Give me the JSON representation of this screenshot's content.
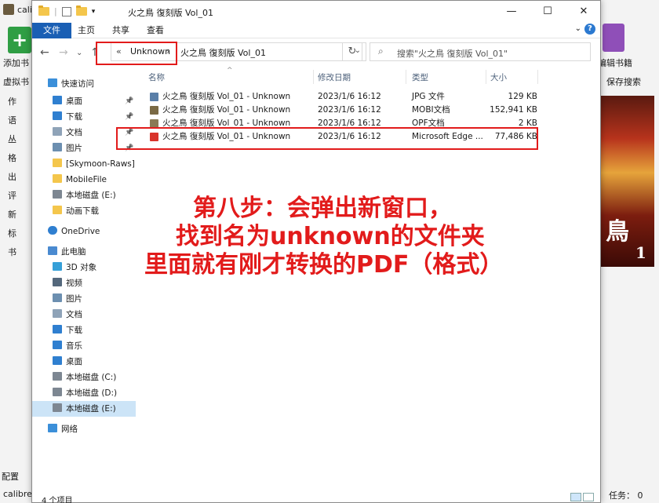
{
  "calibre": {
    "title": "calibre",
    "add_books": "添加书",
    "edit_books": "编辑书籍",
    "virtual_library": "虚拟书",
    "save_search": "保存搜索",
    "side_items": [
      "作",
      "语",
      "丛",
      "格",
      "出",
      "评",
      "新",
      "标",
      "书"
    ],
    "cover_big": "鳥",
    "cover_num": "1",
    "configure": "配置",
    "bottom": "calibre",
    "tasks": "任务：  0"
  },
  "explorer": {
    "title": "火之鳥 復刻版 Vol_01",
    "ribbon": {
      "file": "文件",
      "home": "主页",
      "share": "共享",
      "view": "查看"
    },
    "address": {
      "prefix": "«",
      "seg1": "Unknown",
      "sep": "›",
      "seg2": "火之鳥 復刻版 Vol_01"
    },
    "search_placeholder": "搜索\"火之鳥 復刻版 Vol_01\"",
    "nav": [
      {
        "label": "快速访问",
        "icon": "star-icon",
        "pin": false
      },
      {
        "label": "桌面",
        "icon": "desktop-icon",
        "pin": true
      },
      {
        "label": "下载",
        "icon": "download-icon",
        "pin": true
      },
      {
        "label": "文档",
        "icon": "document-icon",
        "pin": true
      },
      {
        "label": "图片",
        "icon": "picture-icon",
        "pin": true
      },
      {
        "label": "[Skymoon-Raws] I",
        "icon": "folder-icon",
        "pin": false
      },
      {
        "label": "MobileFile",
        "icon": "folder-icon",
        "pin": false
      },
      {
        "label": "本地磁盘 (E:)",
        "icon": "drive-icon",
        "pin": false
      },
      {
        "label": "动画下载",
        "icon": "folder-icon",
        "pin": false
      },
      {
        "label": "OneDrive",
        "icon": "cloud-icon",
        "pin": false
      },
      {
        "label": "此电脑",
        "icon": "computer-icon",
        "pin": false
      },
      {
        "label": "3D 对象",
        "icon": "cube-icon",
        "pin": false
      },
      {
        "label": "视频",
        "icon": "video-icon",
        "pin": false
      },
      {
        "label": "图片",
        "icon": "picture-icon",
        "pin": false
      },
      {
        "label": "文档",
        "icon": "document-icon",
        "pin": false
      },
      {
        "label": "下载",
        "icon": "download-icon",
        "pin": false
      },
      {
        "label": "音乐",
        "icon": "music-icon",
        "pin": false
      },
      {
        "label": "桌面",
        "icon": "desktop-icon",
        "pin": false
      },
      {
        "label": "本地磁盘 (C:)",
        "icon": "drive-icon",
        "pin": false
      },
      {
        "label": "本地磁盘 (D:)",
        "icon": "drive-icon",
        "pin": false
      },
      {
        "label": "本地磁盘 (E:)",
        "icon": "drive-icon",
        "pin": false
      },
      {
        "label": "网络",
        "icon": "network-icon",
        "pin": false
      }
    ],
    "columns": {
      "name": "名称",
      "date": "修改日期",
      "type": "类型",
      "size": "大小"
    },
    "files": [
      {
        "name": "火之鳥 復刻版 Vol_01 - Unknown",
        "date": "2023/1/6 16:12",
        "type": "JPG 文件",
        "size": "129 KB",
        "icon": "jpg-file-icon"
      },
      {
        "name": "火之鳥 復刻版 Vol_01 - Unknown",
        "date": "2023/1/6 16:12",
        "type": "MOBI文档",
        "size": "152,941 KB",
        "icon": "mobi-file-icon"
      },
      {
        "name": "火之鳥 復刻版 Vol_01 - Unknown",
        "date": "2023/1/6 16:12",
        "type": "OPF文档",
        "size": "2 KB",
        "icon": "opf-file-icon"
      },
      {
        "name": "火之鳥 復刻版 Vol_01 - Unknown",
        "date": "2023/1/6 16:12",
        "type": "Microsoft Edge ...",
        "size": "77,486 KB",
        "icon": "pdf-file-icon"
      }
    ],
    "status_count": "4 个项目"
  },
  "annotation": {
    "line1": "第八步：会弹出新窗口，",
    "line2": "找到名为unknown的文件夹",
    "line3": "里面就有刚才转换的PDF（格式）",
    "color": "#e21b1b"
  }
}
